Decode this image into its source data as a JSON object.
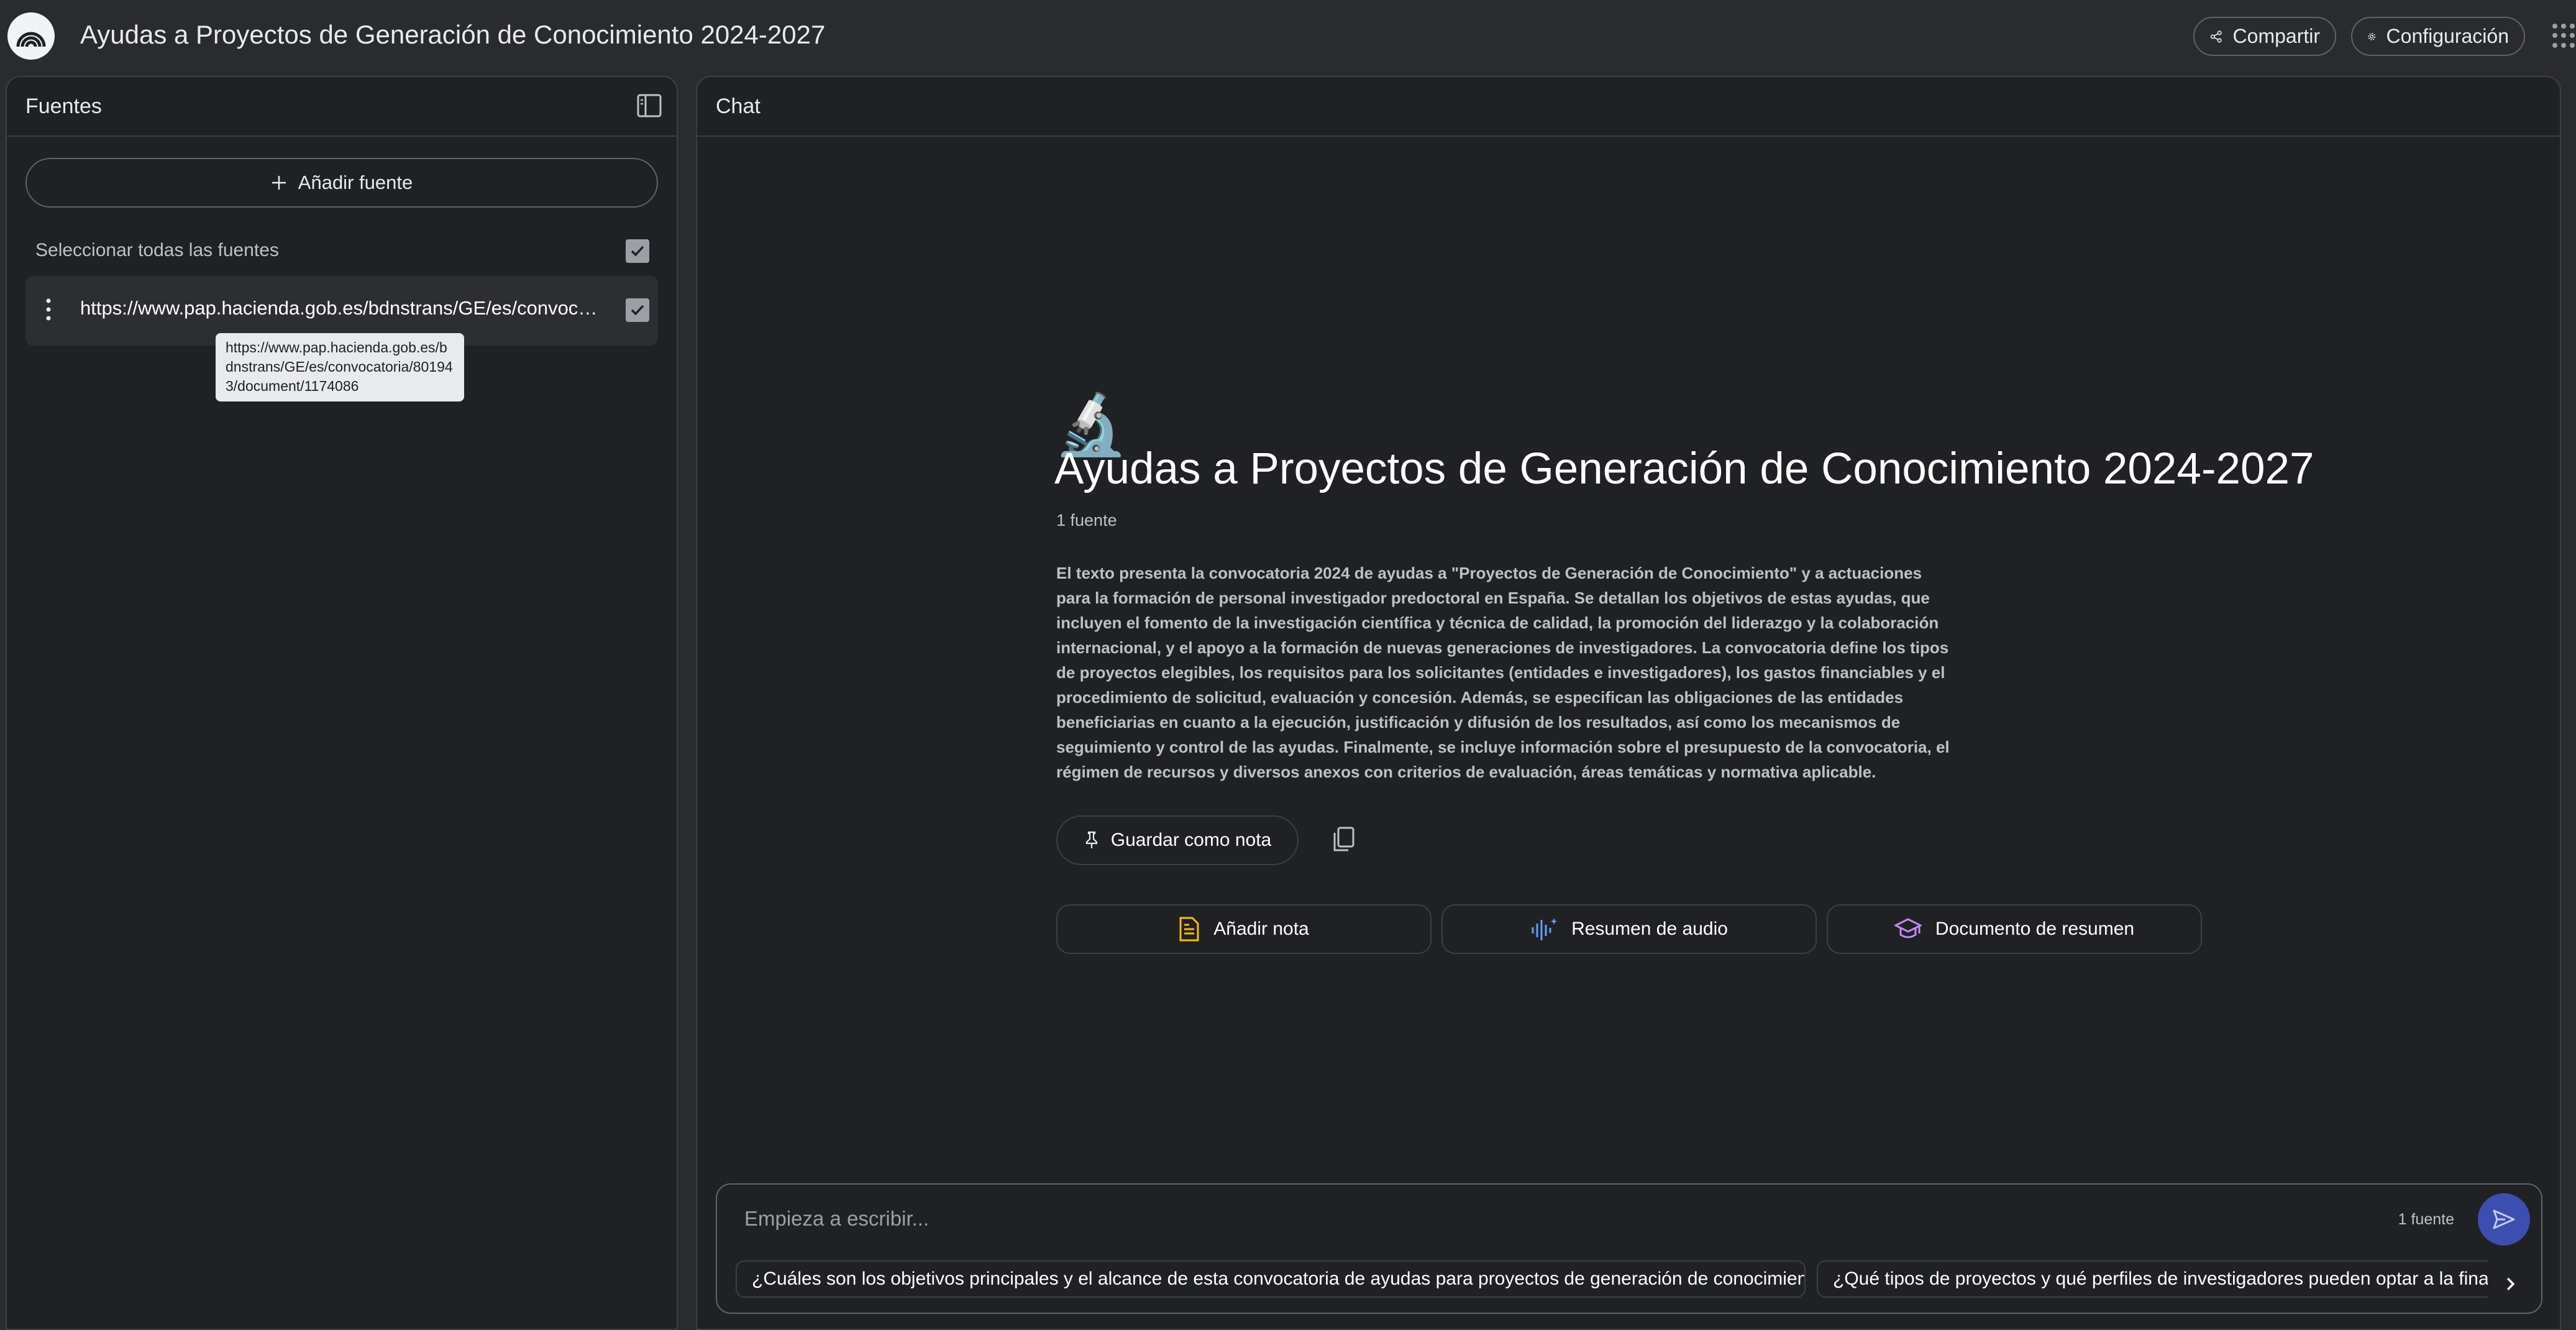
{
  "app": {
    "title": "Ayudas a Proyectos de Generación de Conocimiento 2024-2027",
    "share_label": "Compartir",
    "settings_label": "Configuración"
  },
  "sources": {
    "title": "Fuentes",
    "add_label": "Añadir fuente",
    "select_all_label": "Seleccionar todas las fuentes",
    "items": [
      {
        "url": "https://www.pap.hacienda.gob.es/bdnstrans/GE/es/convocatoria/801943/document/1174086",
        "checked": true
      }
    ],
    "tooltip": "https://www.pap.hacienda.gob.es/bdnstrans/GE/es/convocatoria/801943/document/1174086"
  },
  "chat": {
    "title": "Chat",
    "emoji": "🔬",
    "notebook_title": "Ayudas a Proyectos de Generación de Conocimiento 2024-2027",
    "source_count": "1 fuente",
    "summary": "El texto presenta la convocatoria 2024 de ayudas a \"Proyectos de Generación de Conocimiento\" y a actuaciones para la formación de personal investigador predoctoral en España. Se detallan los objetivos de estas ayudas, que incluyen el fomento de la investigación científica y técnica de calidad, la promoción del liderazgo y la colaboración internacional, y el apoyo a la formación de nuevas generaciones de investigadores. La convocatoria define los tipos de proyectos elegibles, los requisitos para los solicitantes (entidades e investigadores), los gastos financiables y el procedimiento de solicitud, evaluación y concesión. Además, se especifican las obligaciones de las entidades beneficiarias en cuanto a la ejecución, justificación y difusión de los resultados, así como los mecanismos de seguimiento y control de las ayudas. Finalmente, se incluye información sobre el presupuesto de la convocatoria, el régimen de recursos y diversos anexos con criterios de evaluación, áreas temáticas y normativa aplicable.",
    "save_note_label": "Guardar como nota",
    "actions": {
      "add_note": "Añadir nota",
      "audio_summary": "Resumen de audio",
      "doc_summary": "Documento de resumen"
    },
    "input_placeholder": "Empieza a escribir...",
    "input_source_count": "1 fuente",
    "suggestions": [
      "¿Cuáles son los objetivos principales y el alcance de esta convocatoria de ayudas para proyectos de generación de conocimiento?",
      "¿Qué tipos de proyectos y qué perfiles de investigadores pueden optar a la financiación?"
    ]
  },
  "colors": {
    "background": "#2a2b2f",
    "panel": "#202124",
    "accent": "#8ab4f8",
    "send_button": "#3c4eb0",
    "note_icon": "#fbbc04",
    "audio_icon": "#669df6",
    "doc_icon": "#c58af9"
  }
}
